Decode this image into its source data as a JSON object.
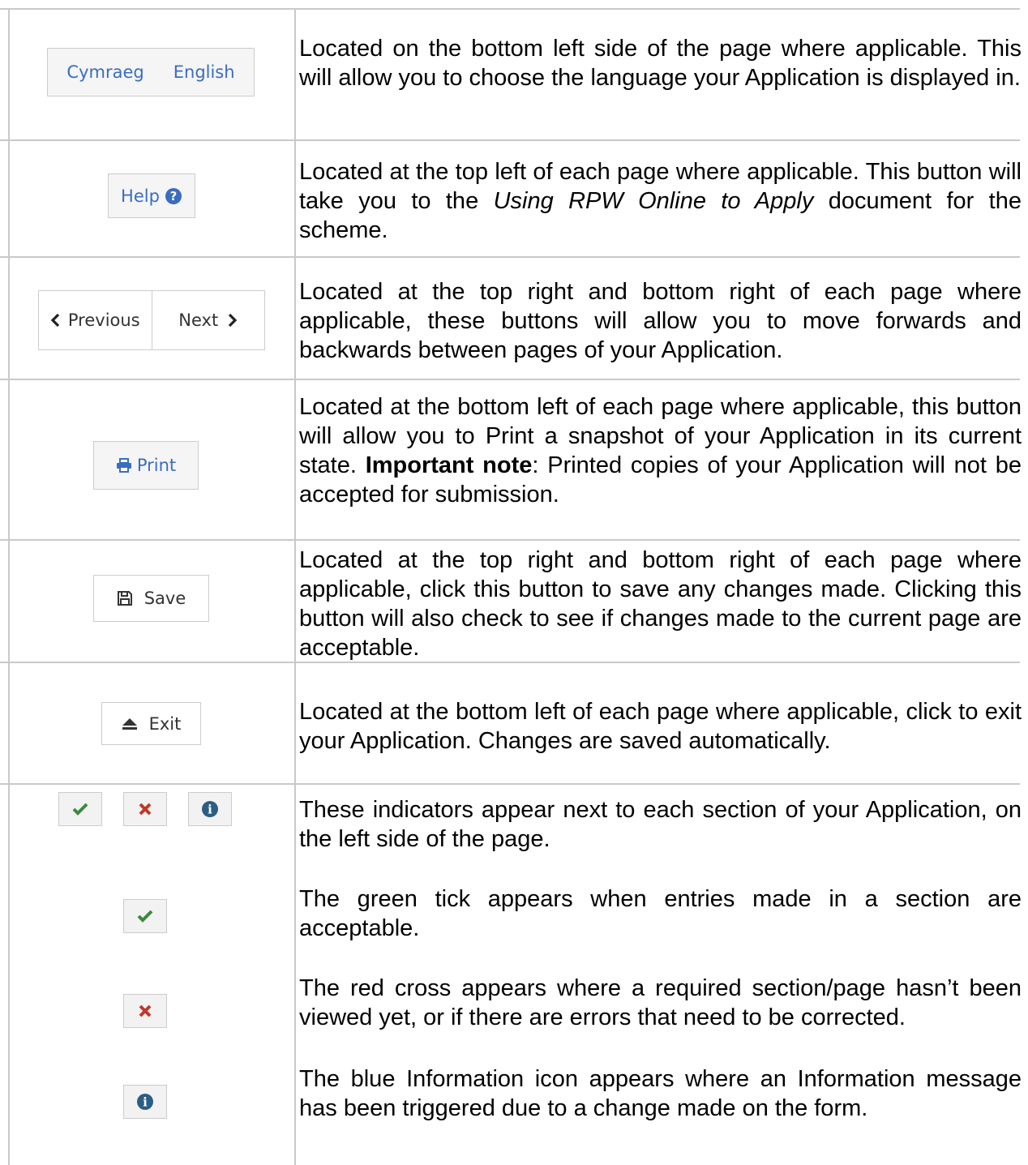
{
  "rows": {
    "language": {
      "buttons": [
        "Cymraeg",
        "English"
      ],
      "text": "Located on the bottom left side of the page where applicable. This will allow you to choose the language your Application is displayed in."
    },
    "help": {
      "button_label": "Help",
      "text_before": "Located at the top left of each page where applicable. This button will take you to the ",
      "text_italic": "Using RPW Online to Apply",
      "text_after": " document for the scheme."
    },
    "prevnext": {
      "prev_label": "Previous",
      "next_label": "Next",
      "text": "Located at the top right and bottom right of each page where applicable, these buttons will allow you to move forwards and backwards between pages of your Application."
    },
    "print": {
      "button_label": "Print",
      "text_before": "Located at the bottom left of each page where applicable, this button will allow you to Print a snapshot of your Application in its current state. ",
      "text_bold": "Important note",
      "text_after": ": Printed copies of your Application will not be accepted for submission."
    },
    "save": {
      "button_label": "Save",
      "text": "Located at the top right and bottom right of each page where applicable, click this button to save any changes made. Clicking this button will also check to see if changes made to the current page are acceptable."
    },
    "exit": {
      "button_label": "Exit",
      "text": "Located at the bottom left of each page where applicable, click to exit your Application. Changes are saved automatically."
    },
    "indicators": {
      "intro": "These indicators appear next to each section of your Application, on the left side of the page.",
      "tick": "The green tick appears when entries made in a section are acceptable.",
      "cross": "The red cross appears where a required section/page hasn’t been viewed yet, or if there are errors that need to be corrected.",
      "info": "The blue Information icon appears where an Information message has been triggered due to a change made on the form."
    }
  },
  "colors": {
    "border": "#c9c9c9",
    "green_tick": "#3c8a3c",
    "red_cross": "#c0392b",
    "info_blue": "#2c5d83",
    "link_blue": "#3a6dbf"
  },
  "icons": [
    "help-question-icon",
    "chevron-left-icon",
    "chevron-right-icon",
    "print-icon",
    "save-icon",
    "eject-icon",
    "check-icon",
    "cross-icon",
    "info-icon"
  ]
}
